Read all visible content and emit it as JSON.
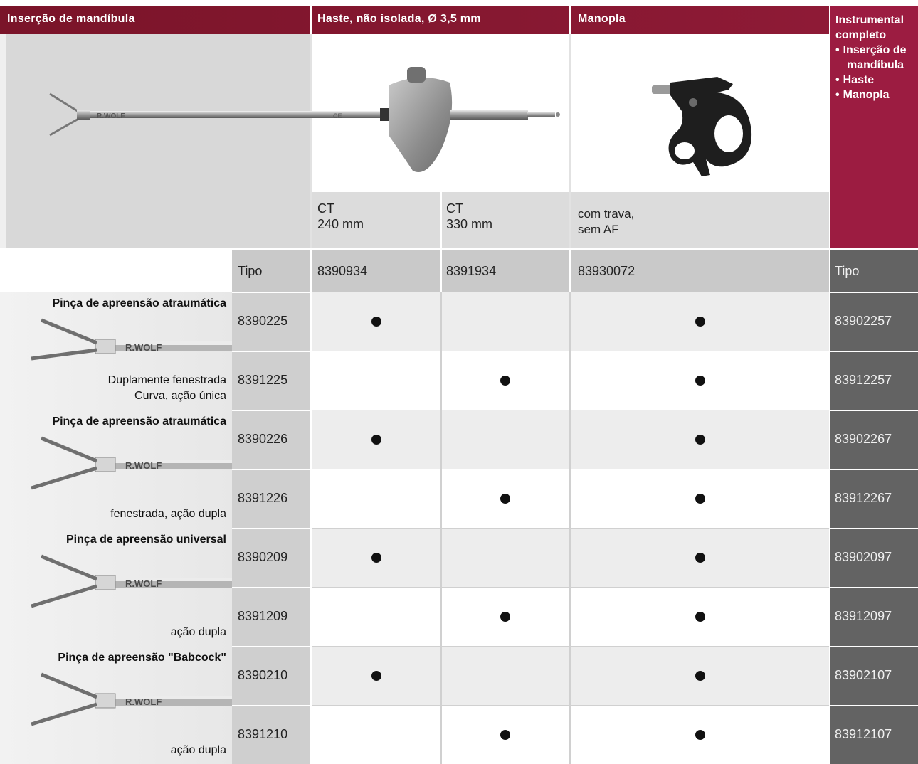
{
  "header": {
    "col1": "Inserção de mandíbula",
    "col2": "Haste, não isolada, Ø 3,5 mm",
    "col3": "Manopla",
    "col4_title_1": "Instrumental",
    "col4_title_2": "completo",
    "col4_items": [
      "Inserção de mandíbula",
      "Haste",
      "Manopla"
    ]
  },
  "images": {
    "jaw_brand": "R.WOLF",
    "shaft_mark": "CE"
  },
  "variants": {
    "shaft_240_line1": "CT",
    "shaft_240_line2": "240 mm",
    "shaft_330_line1": "CT",
    "shaft_330_line2": "330 mm",
    "handle_line1": "com trava,",
    "handle_line2": "sem AF"
  },
  "type_row": {
    "label": "Tipo",
    "shaft_240": "8390934",
    "shaft_330": "8391934",
    "handle": "83930072",
    "complete_label": "Tipo"
  },
  "groups": [
    {
      "title": "Pinça de apreensão atraumática",
      "desc_lines": [
        "Duplamente fenestrada",
        "Curva, ação única"
      ],
      "brand": "R.WOLF",
      "rows": [
        {
          "type": "8390225",
          "complete": "83902257",
          "shaft240": true,
          "shaft330": false,
          "handle": true
        },
        {
          "type": "8391225",
          "complete": "83912257",
          "shaft240": false,
          "shaft330": true,
          "handle": true
        }
      ]
    },
    {
      "title": "Pinça de apreensão atraumática",
      "desc_lines": [
        "fenestrada, ação dupla"
      ],
      "brand": "R.WOLF",
      "rows": [
        {
          "type": "8390226",
          "complete": "83902267",
          "shaft240": true,
          "shaft330": false,
          "handle": true
        },
        {
          "type": "8391226",
          "complete": "83912267",
          "shaft240": false,
          "shaft330": true,
          "handle": true
        }
      ]
    },
    {
      "title": "Pinça de apreensão universal",
      "desc_lines": [
        "ação dupla"
      ],
      "brand": "R.WOLF",
      "rows": [
        {
          "type": "8390209",
          "complete": "83902097",
          "shaft240": true,
          "shaft330": false,
          "handle": true
        },
        {
          "type": "8391209",
          "complete": "83912097",
          "shaft240": false,
          "shaft330": true,
          "handle": true
        }
      ]
    },
    {
      "title": "Pinça de apreensão \"Babcock\"",
      "desc_lines": [
        "ação dupla"
      ],
      "brand": "R.WOLF",
      "rows": [
        {
          "type": "8390210",
          "complete": "83902107",
          "shaft240": true,
          "shaft330": false,
          "handle": true
        },
        {
          "type": "8391210",
          "complete": "83912107",
          "shaft240": false,
          "shaft330": true,
          "handle": true
        }
      ]
    }
  ]
}
